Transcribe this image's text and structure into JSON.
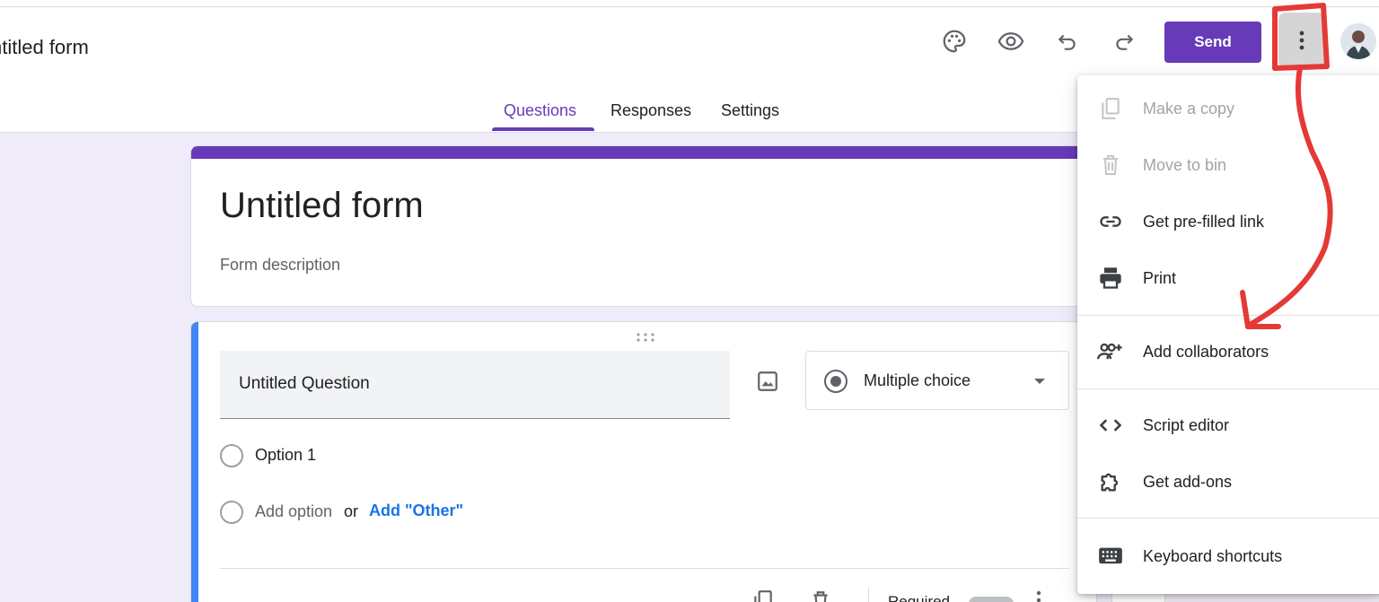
{
  "header": {
    "doc_title": "ntitled form",
    "send_label": "Send",
    "icons": [
      "palette-icon",
      "eye-icon",
      "undo-icon",
      "redo-icon",
      "more-vert-icon"
    ]
  },
  "tabs": [
    {
      "label": "Questions",
      "active": true
    },
    {
      "label": "Responses",
      "active": false
    },
    {
      "label": "Settings",
      "active": false
    }
  ],
  "form": {
    "title": "Untitled form",
    "description": "Form description"
  },
  "question": {
    "title": "Untitled Question",
    "type": "Multiple choice",
    "option1": "Option 1",
    "add_option": "Add option",
    "or": "or",
    "add_other": "Add \"Other\"",
    "required_partial": "Required"
  },
  "menu": {
    "items": [
      {
        "label": "Make a copy",
        "icon": "copy-icon",
        "disabled": true
      },
      {
        "label": "Move to bin",
        "icon": "trash-icon",
        "disabled": true
      },
      {
        "label": "Get pre-filled link",
        "icon": "link-icon",
        "disabled": false
      },
      {
        "label": "Print",
        "icon": "print-icon",
        "disabled": false
      },
      {
        "label": "Add collaborators",
        "icon": "add-people-icon",
        "disabled": false
      },
      {
        "label": "Script editor",
        "icon": "code-icon",
        "disabled": false
      },
      {
        "label": "Get add-ons",
        "icon": "puzzle-icon",
        "disabled": false
      },
      {
        "label": "Keyboard shortcuts",
        "icon": "keyboard-icon",
        "disabled": false
      }
    ]
  },
  "colors": {
    "brand": "#673ab7",
    "question_accent": "#4285f4",
    "link": "#1a73e8",
    "annotation": "#e53935"
  }
}
